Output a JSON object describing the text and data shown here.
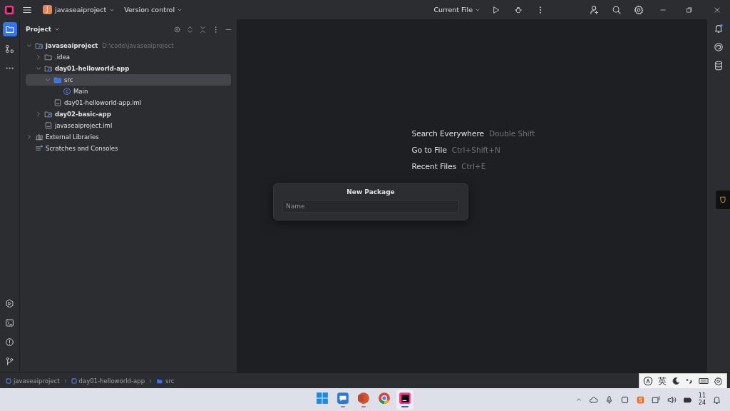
{
  "title_bar": {
    "logo_letter": "J",
    "project": "javaseaiproject",
    "vcs": "Version control",
    "run_config": "Current File"
  },
  "project_panel": {
    "title": "Project",
    "tree": [
      {
        "label": "javaseaiproject",
        "hint": "D:\\code\\javaseaiproject",
        "kind": "module",
        "bold": true,
        "expanded": true,
        "selected": false,
        "children": [
          {
            "label": ".idea",
            "kind": "folder",
            "bold": false,
            "expanded": false,
            "selected": false
          },
          {
            "label": "day01-helloworld-app",
            "kind": "module",
            "bold": true,
            "expanded": true,
            "selected": false,
            "children": [
              {
                "label": "src",
                "kind": "source",
                "bold": false,
                "expanded": true,
                "selected": true,
                "children": [
                  {
                    "label": "Main",
                    "kind": "class",
                    "bold": false,
                    "selected": false
                  }
                ]
              },
              {
                "label": "day01-helloworld-app.iml",
                "kind": "file",
                "bold": false,
                "selected": false
              }
            ]
          },
          {
            "label": "day02-basic-app",
            "kind": "module",
            "bold": true,
            "expanded": false,
            "selected": false
          },
          {
            "label": "javaseaiproject.iml",
            "kind": "file",
            "bold": false,
            "selected": false
          }
        ]
      },
      {
        "label": "External Libraries",
        "kind": "library",
        "bold": false,
        "expanded": false,
        "selected": false
      },
      {
        "label": "Scratches and Consoles",
        "kind": "scratch",
        "bold": false,
        "selected": false
      }
    ]
  },
  "editor_hints": [
    {
      "action": "Search Everywhere",
      "shortcut": "Double Shift"
    },
    {
      "action": "Go to File",
      "shortcut": "Ctrl+Shift+N"
    },
    {
      "action": "Recent Files",
      "shortcut": "Ctrl+E"
    }
  ],
  "new_package_dialog": {
    "title": "New Package",
    "placeholder": "Name"
  },
  "breadcrumbs": [
    {
      "label": "javaseaiproject",
      "kind": "module"
    },
    {
      "label": "day01-helloworld-app",
      "kind": "module"
    },
    {
      "label": "src",
      "kind": "folder"
    }
  ],
  "ime_bar": {
    "mode": "英"
  },
  "taskbar": {
    "apps": [
      {
        "kind": "start",
        "running": false
      },
      {
        "kind": "chat",
        "running": true
      },
      {
        "kind": "slides",
        "running": true
      },
      {
        "kind": "browser",
        "running": false
      },
      {
        "kind": "ide",
        "running": true
      }
    ],
    "clock": [
      "11",
      "24"
    ]
  }
}
